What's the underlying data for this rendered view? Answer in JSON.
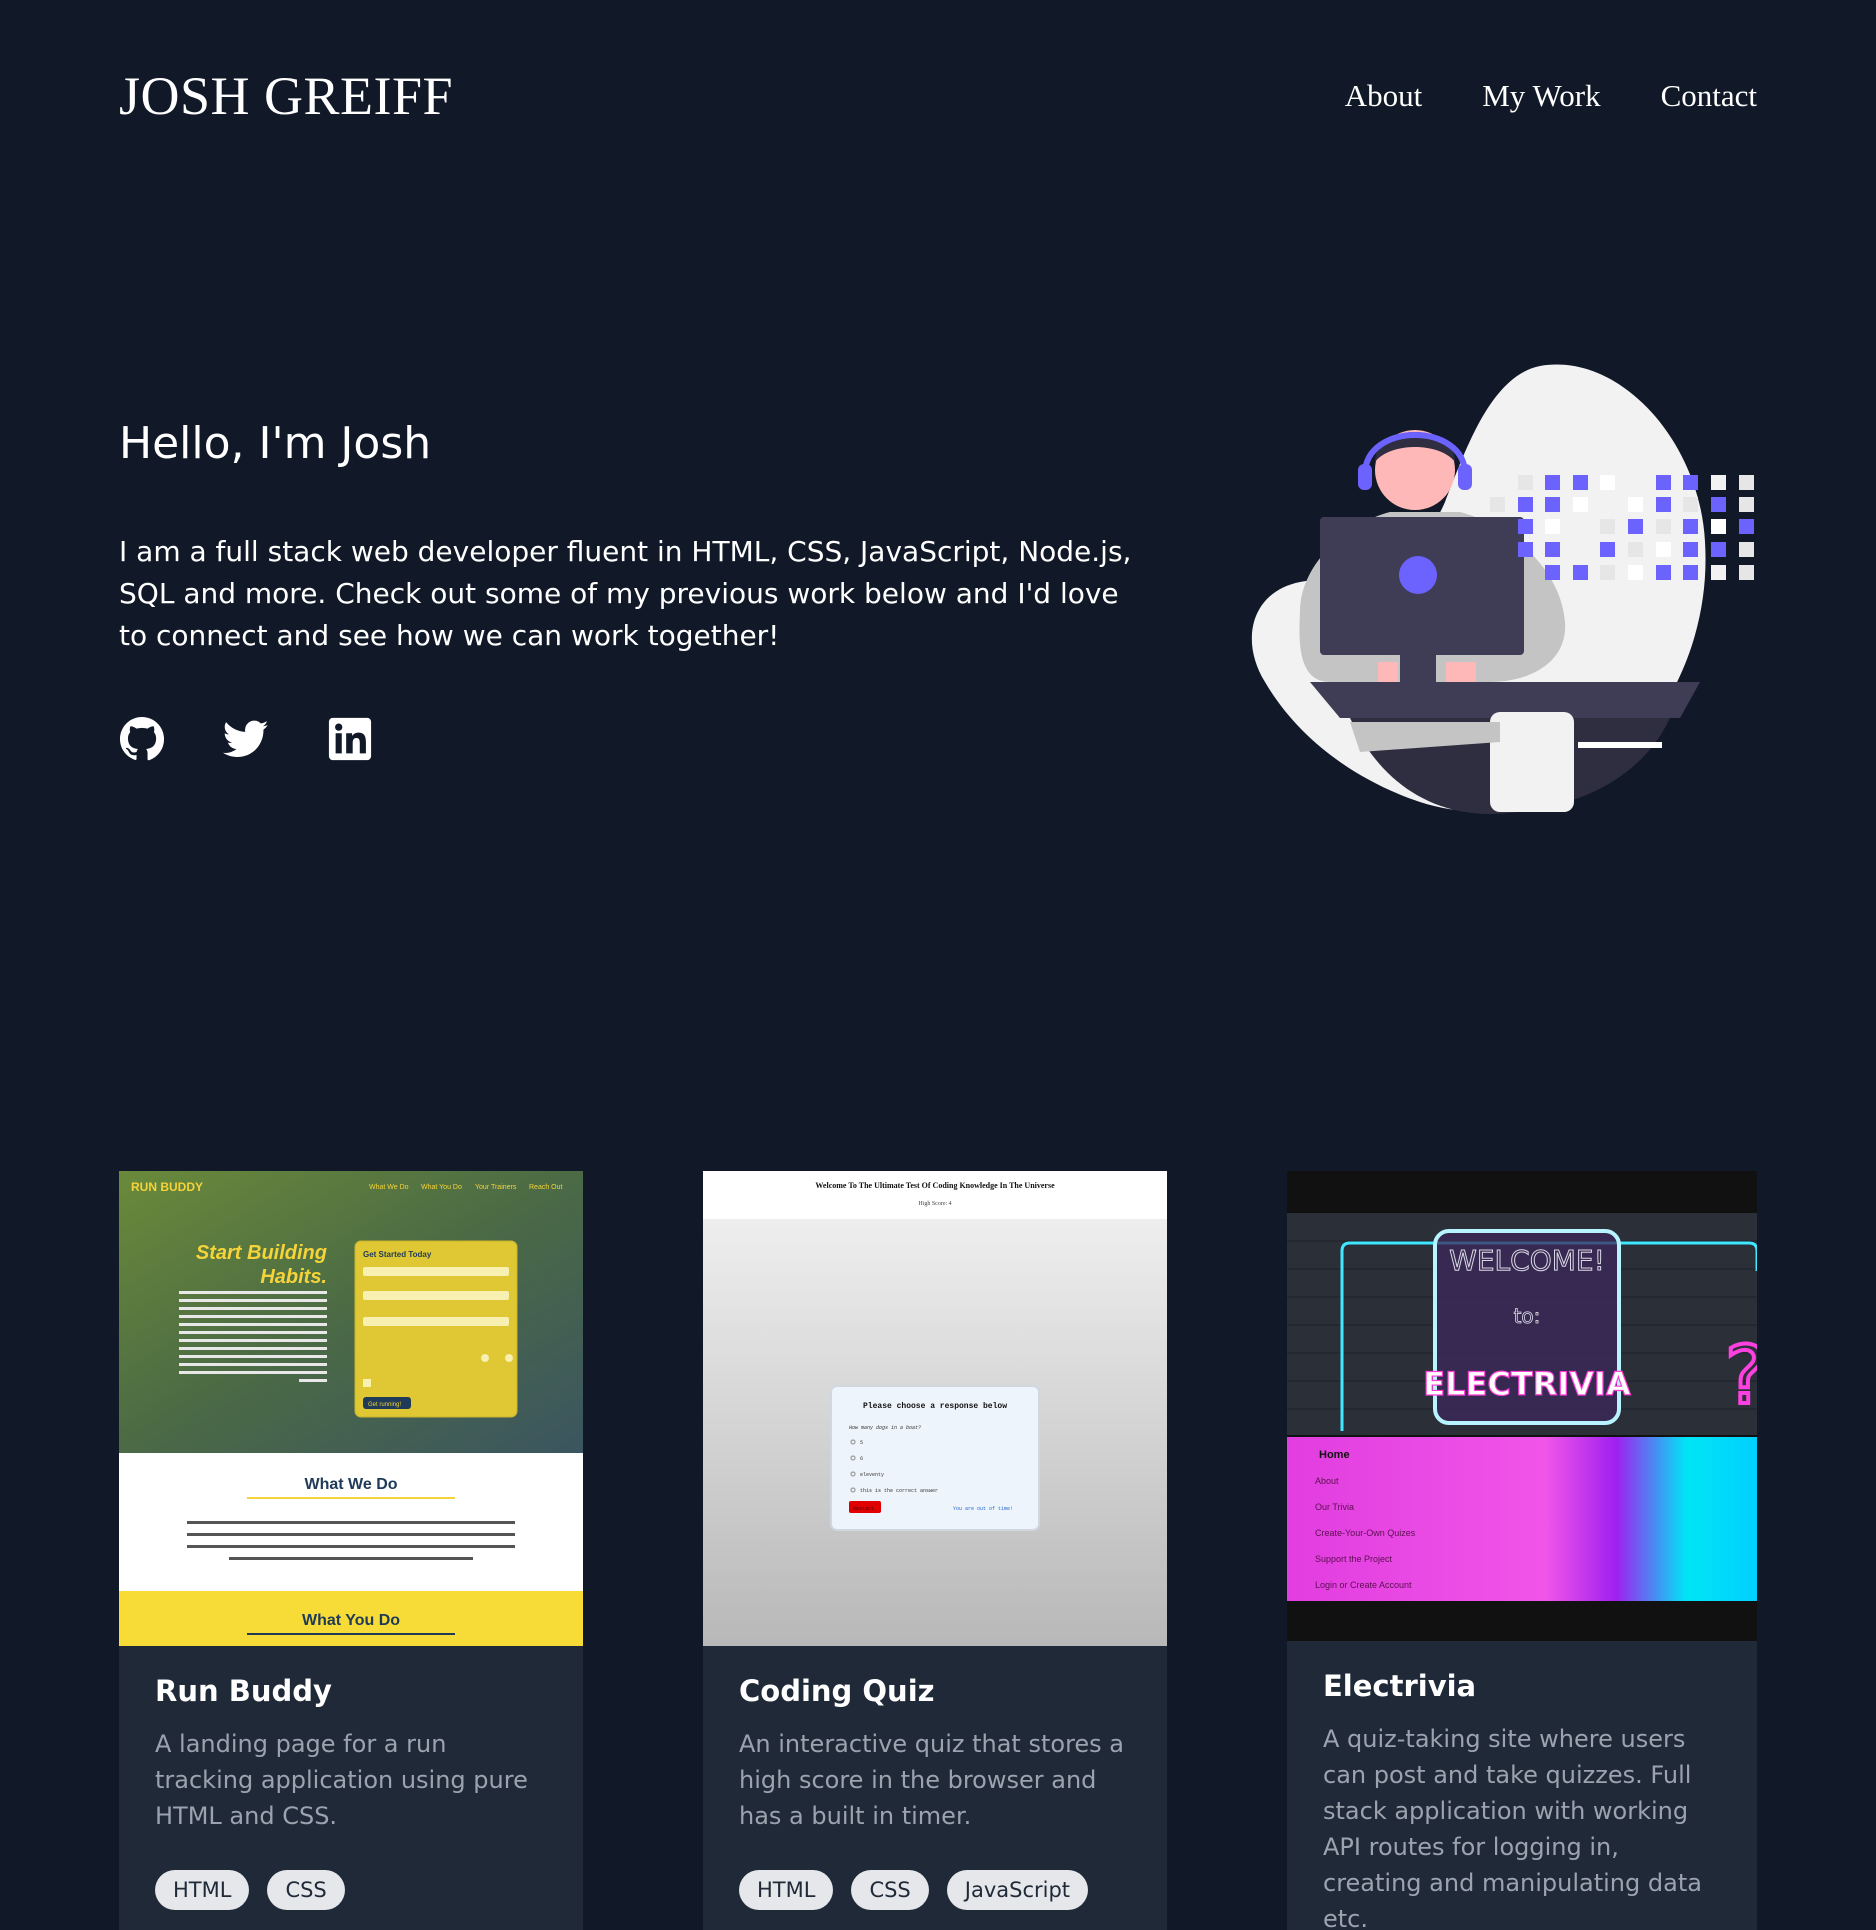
{
  "header": {
    "logo": "JOSH GREIFF",
    "nav": [
      {
        "label": "About"
      },
      {
        "label": "My Work"
      },
      {
        "label": "Contact"
      }
    ]
  },
  "hero": {
    "title": "Hello, I'm Josh",
    "text": "I am a full stack web developer fluent in HTML, CSS, JavaScript, Node.js, SQL and more. Check out some of my previous work below and I'd love to connect and see how we can work together!",
    "socials": [
      "github-icon",
      "twitter-icon",
      "linkedin-icon"
    ]
  },
  "projects": [
    {
      "title": "Run Buddy",
      "description": "A landing page for a run tracking application using pure HTML and CSS.",
      "tags": [
        "HTML",
        "CSS"
      ],
      "thumb": {
        "brand": "RUN BUDDY",
        "nav": [
          "What We Do",
          "What You Do",
          "Your Trainers",
          "Reach Out"
        ],
        "headline1": "Start Building",
        "headline2": "Habits.",
        "form_title": "Get Started Today",
        "form_button": "Get running!",
        "section1": "What We Do",
        "section2": "What You Do"
      }
    },
    {
      "title": "Coding Quiz",
      "description": "An interactive quiz that stores a high score in the browser and has a built in timer.",
      "tags": [
        "HTML",
        "CSS",
        "JavaScript"
      ],
      "thumb": {
        "heading": "Welcome To The Ultimate Test Of Coding Knowledge In The Universe",
        "high_score": "High Score: 4",
        "panel_title": "Please choose a response below",
        "question": "How many dogs in a boat?",
        "options": [
          "5",
          "6",
          "eleventy",
          "this is the correct answer"
        ],
        "button": "Restart",
        "status": "You are out of time!"
      }
    },
    {
      "title": "Electrivia",
      "description": "A quiz-taking site where users can post and take quizzes. Full stack application with working API routes for logging in, creating and manipulating data etc.",
      "tags": [],
      "thumb": {
        "sign1": "WELCOME!",
        "sign2": "to:",
        "sign3": "ELECTRIVIA",
        "menu": [
          "Home",
          "About",
          "Our Trivia",
          "Create-Your-Own Quizes",
          "Support the Project",
          "Login or Create Account"
        ]
      }
    }
  ],
  "colors": {
    "background": "#111827",
    "card": "#1f2937",
    "accent": "#6c63ff",
    "muted_text": "#9ca3af"
  }
}
